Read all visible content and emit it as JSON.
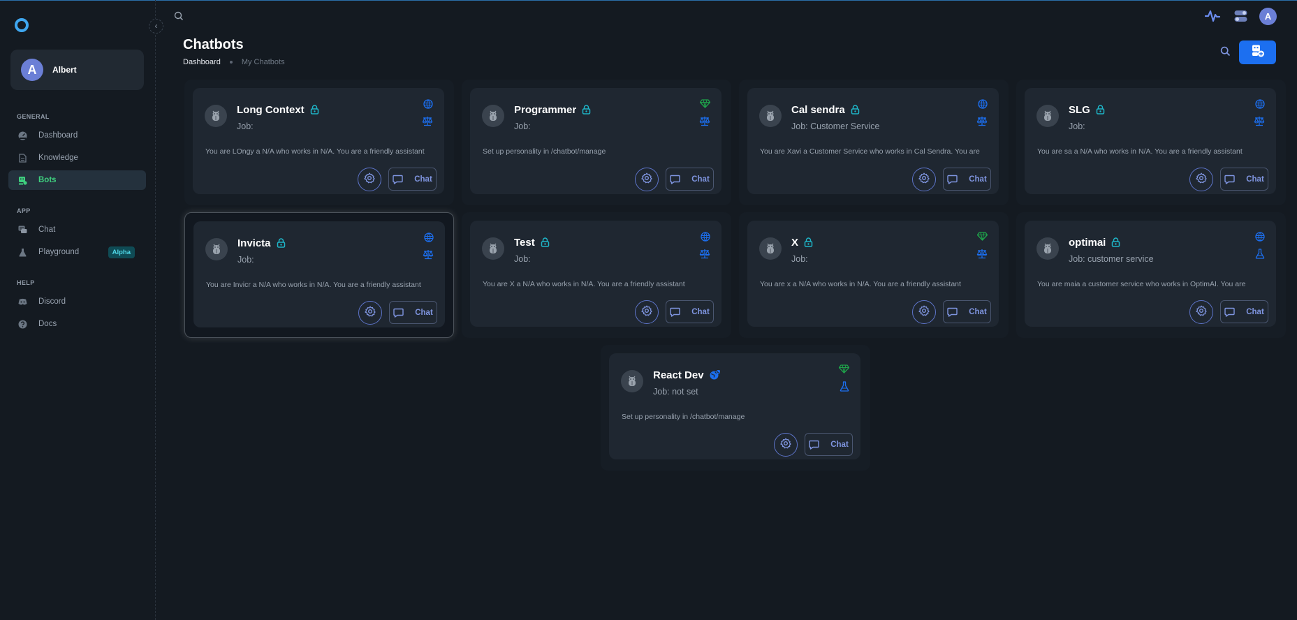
{
  "sidebar": {
    "user_name": "Albert",
    "user_initial": "A",
    "sections": [
      {
        "title": "GENERAL",
        "items": [
          {
            "label": "Dashboard",
            "icon": "dashboard-icon"
          },
          {
            "label": "Knowledge",
            "icon": "document-icon"
          },
          {
            "label": "Bots",
            "icon": "bot-icon",
            "active": true
          }
        ]
      },
      {
        "title": "APP",
        "items": [
          {
            "label": "Chat",
            "icon": "chat-icon"
          },
          {
            "label": "Playground",
            "icon": "flask-icon",
            "badge": "Alpha"
          }
        ]
      },
      {
        "title": "HELP",
        "items": [
          {
            "label": "Discord",
            "icon": "discord-icon"
          },
          {
            "label": "Docs",
            "icon": "help-icon"
          }
        ]
      }
    ]
  },
  "header": {
    "avatar_initial": "A"
  },
  "page": {
    "title": "Chatbots",
    "breadcrumb": [
      "Dashboard",
      "My Chatbots"
    ]
  },
  "colors": {
    "accent": "#1c6ff0",
    "active_nav": "#3fd07f",
    "lock": "#1fb5c8",
    "globe": "#1c6ff0",
    "diamond": "#1fa34a"
  },
  "bots": [
    {
      "name": "Long Context",
      "job": "Job:",
      "desc": "You are LOngy a N/A who works in N/A. You are a friendly assistant",
      "badge": "lock",
      "top_icon": "globe-icon",
      "mid_icon": "scale-icon",
      "chat": "Chat"
    },
    {
      "name": "Programmer",
      "job": "Job:",
      "desc": "Set up personality in /chatbot/manage",
      "badge": "lock",
      "top_icon": "diamond-icon",
      "mid_icon": "scale-icon",
      "chat": "Chat"
    },
    {
      "name": "Cal sendra",
      "job": "Job: Customer Service",
      "desc": "You are Xavi a Customer Service who works in Cal Sendra. You are",
      "badge": "lock",
      "top_icon": "globe-icon",
      "mid_icon": "scale-icon",
      "chat": "Chat"
    },
    {
      "name": "SLG",
      "job": "Job:",
      "desc": "You are sa a N/A who works in N/A. You are a friendly assistant",
      "badge": "lock",
      "top_icon": "globe-icon",
      "mid_icon": "scale-icon",
      "chat": "Chat"
    },
    {
      "name": "Invicta",
      "job": "Job:",
      "desc": "You are Invicr a N/A who works in N/A. You are a friendly assistant",
      "badge": "lock",
      "top_icon": "globe-icon",
      "mid_icon": "scale-icon",
      "chat": "Chat",
      "selected": true
    },
    {
      "name": "Test",
      "job": "Job:",
      "desc": "You are X a N/A who works in N/A. You are a friendly assistant",
      "badge": "lock",
      "top_icon": "globe-icon",
      "mid_icon": "scale-icon",
      "chat": "Chat"
    },
    {
      "name": "X",
      "job": "Job:",
      "desc": "You are x a N/A who works in N/A. You are a friendly assistant",
      "badge": "lock",
      "top_icon": "diamond-icon",
      "mid_icon": "scale-icon",
      "chat": "Chat"
    },
    {
      "name": "optimai",
      "job": "Job: customer service",
      "desc": "You are maia a customer service who works in OptimAI. You are",
      "badge": "lock",
      "top_icon": "globe-icon",
      "mid_icon": "flask-icon",
      "chat": "Chat"
    },
    {
      "name": "React Dev",
      "job": "Job: not set",
      "desc": "Set up personality in /chatbot/manage",
      "badge": "public",
      "top_icon": "diamond-icon",
      "mid_icon": "flask-icon",
      "chat": "Chat"
    }
  ]
}
